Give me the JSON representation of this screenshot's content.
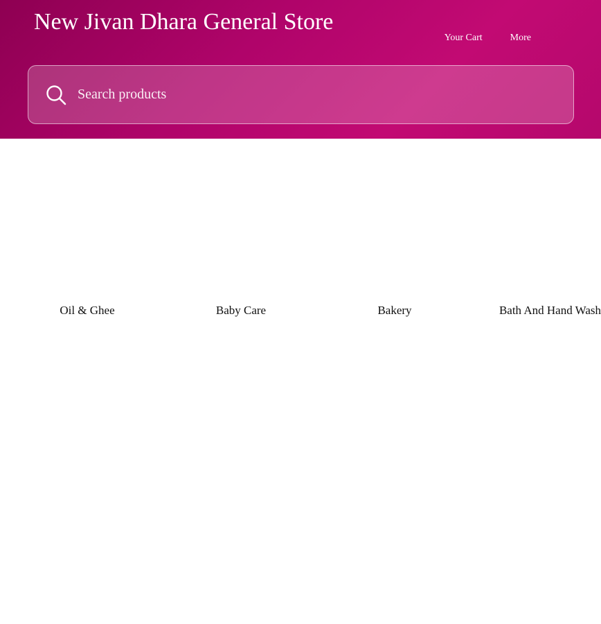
{
  "header": {
    "store_name": "New Jivan Dhara General Store",
    "nav": {
      "cart_label": "Your Cart",
      "more_label": "More"
    },
    "brand_color": "#b0046a"
  },
  "search": {
    "placeholder": "Search products",
    "value": "",
    "icon": "search-icon"
  },
  "categories": [
    {
      "label": "Oil & Ghee"
    },
    {
      "label": "Baby Care"
    },
    {
      "label": "Bakery"
    },
    {
      "label": "Bath And Hand Wash"
    }
  ]
}
